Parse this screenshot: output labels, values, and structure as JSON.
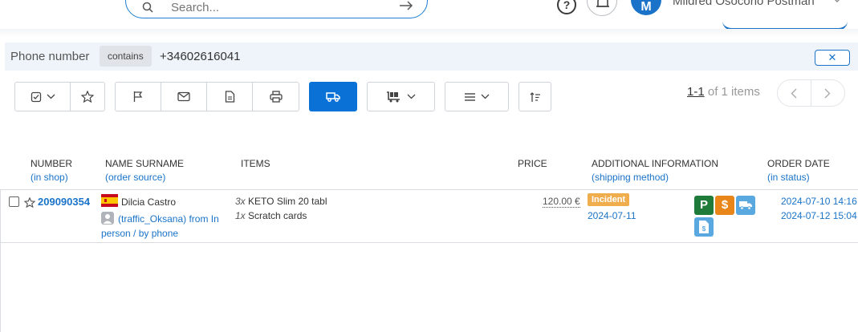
{
  "header": {
    "search_placeholder": "Search...",
    "avatar_initial": "M",
    "user_name": "Mildred Osocorio Postman"
  },
  "filter": {
    "field_label": "Phone number",
    "operator": "contains",
    "value": "+34602616041",
    "close_glyph": "✕"
  },
  "pagination": {
    "range": "1-1",
    "of_text": "of 1 items"
  },
  "table": {
    "columns": [
      {
        "title": "NUMBER",
        "subtitle": "(in shop)"
      },
      {
        "title": "NAME SURNAME",
        "subtitle": "(order source)"
      },
      {
        "title": "ITEMS",
        "subtitle": ""
      },
      {
        "title": "PRICE",
        "subtitle": ""
      },
      {
        "title": "ADDITIONAL INFORMATION",
        "subtitle": "(shipping method)"
      },
      {
        "title": "ORDER DATE",
        "subtitle": "(in status)"
      }
    ],
    "rows": [
      {
        "number": "209090354",
        "customer": "Dilcia Castro",
        "source": "(traffic_Oksana) from In person / by phone",
        "items": [
          {
            "qty": "3x",
            "name": "KETO Slim 20 tabl"
          },
          {
            "qty": "1x",
            "name": "Scratch cards"
          }
        ],
        "price": "120.00 €",
        "status_badge": "Incident",
        "shipping_date": "2024-07-11",
        "icons": {
          "parking": "P",
          "payment": "$",
          "doc": "$"
        },
        "order_date": "2024-07-10 14:16",
        "status_date": "2024-07-12 15:04"
      }
    ]
  },
  "colors": {
    "accent": "#1a73c8",
    "primary_button": "#0a72d6",
    "badge": "#f0ad4e",
    "icon_green": "#1e7b3a",
    "icon_orange": "#e8861a",
    "icon_blue": "#5aa8e0"
  }
}
